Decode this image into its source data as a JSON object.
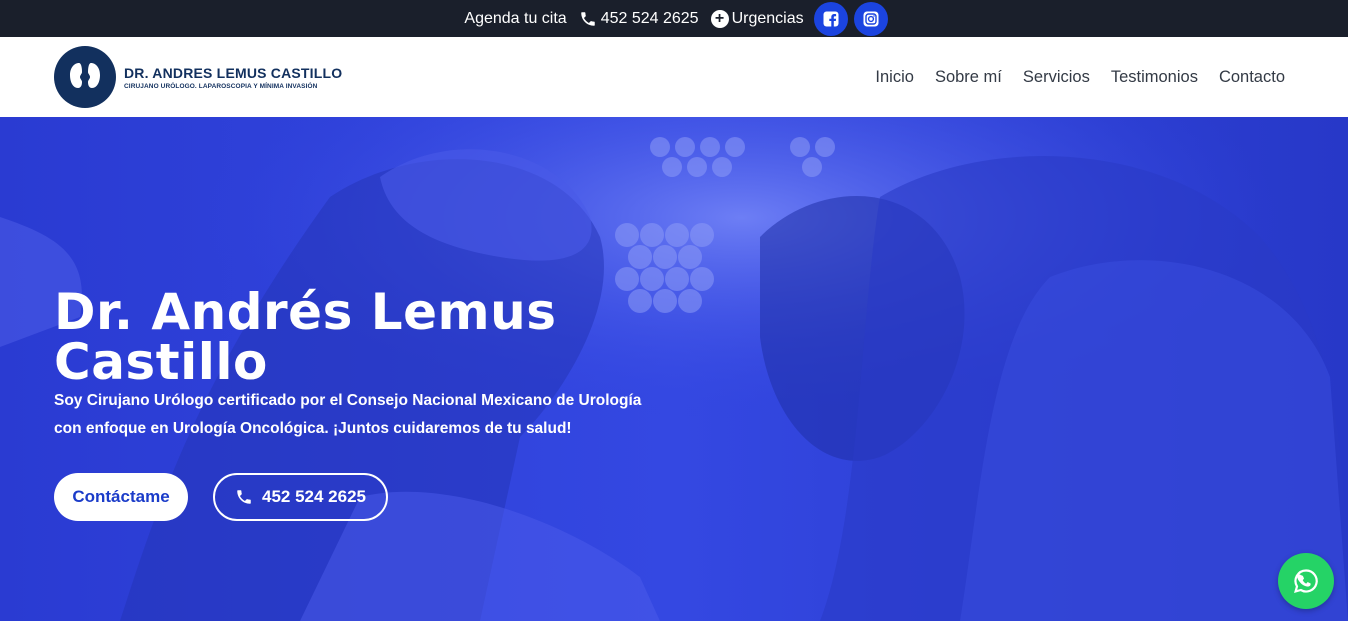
{
  "topbar": {
    "agenda_label": "Agenda tu cita",
    "phone_label": "452 524 2625",
    "urgencias_label": "Urgencias",
    "social": [
      "facebook-icon",
      "instagram-icon"
    ]
  },
  "header": {
    "logo_title": "DR. ANDRES LEMUS CASTILLO",
    "logo_subtitle": "CIRUJANO URÓLOGO. LAPAROSCOPIA Y MÍNIMA INVASIÓN",
    "nav": [
      {
        "label": "Inicio"
      },
      {
        "label": "Sobre mí"
      },
      {
        "label": "Servicios"
      },
      {
        "label": "Testimonios"
      },
      {
        "label": "Contacto"
      }
    ]
  },
  "hero": {
    "title_line1": "Dr. Andrés Lemus",
    "title_line2": "Castillo",
    "subtitle_line1": "Soy Cirujano Urólogo certificado por el Consejo Nacional Mexicano de Urología",
    "subtitle_line2": "con enfoque en Urología Oncológica. ¡Juntos cuidaremos de tu salud!",
    "contact_button": "Contáctame",
    "phone_button": "452 524 2625"
  },
  "colors": {
    "topbar_bg": "#1a1f2b",
    "brand_navy": "#12305e",
    "hero_blue": "#2f43e0",
    "social_blue": "#1b44e0",
    "whatsapp_green": "#25d366"
  }
}
